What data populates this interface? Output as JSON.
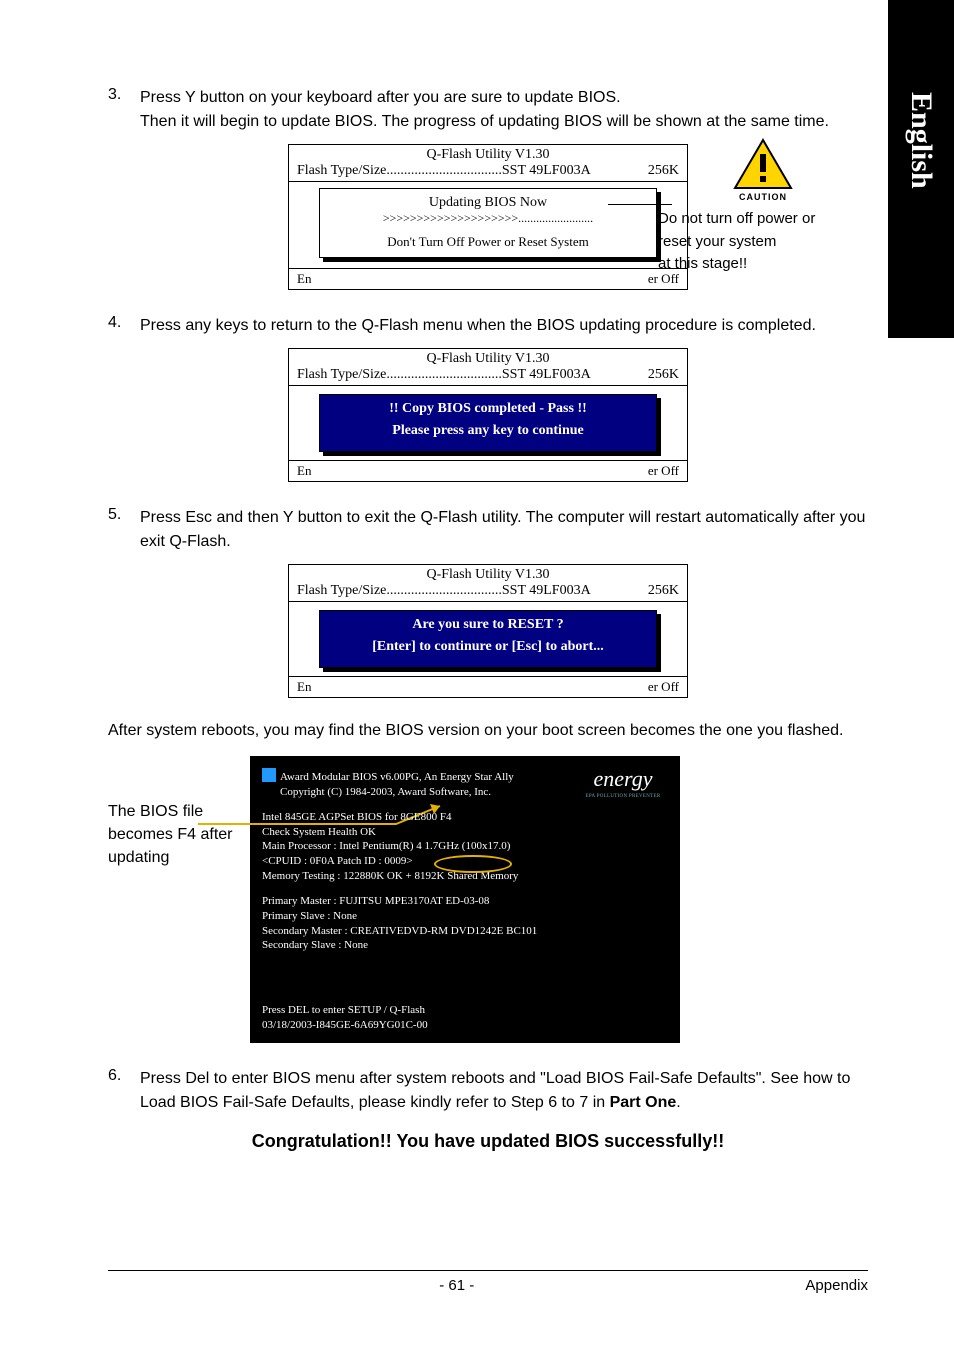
{
  "sideTab": {
    "language": "English"
  },
  "steps": {
    "s3": {
      "num": "3.",
      "line1": "Press Y button on your keyboard after you are sure to update BIOS.",
      "line2": "Then it will begin to update BIOS. The progress of updating BIOS will be shown at the same time."
    },
    "s4": {
      "num": "4.",
      "text": "Press any keys to return to the Q-Flash menu when the BIOS updating procedure is completed."
    },
    "s5": {
      "num": "5.",
      "text": "Press Esc and then Y button to exit the Q-Flash utility. The computer will restart automatically after you exit Q-Flash."
    },
    "s6": {
      "num": "6.",
      "textA": "Press Del to enter BIOS menu after system reboots and \"Load BIOS Fail-Safe Defaults\". See how to Load BIOS Fail-Safe Defaults, please kindly refer to Step 6 to 7 in ",
      "textB": "Part One",
      "textC": "."
    }
  },
  "qflash": {
    "title": "Q-Flash Utility V1.30",
    "flashLabel": "Flash Type/Size.................................SST 49LF003A",
    "flashSize": "256K",
    "footEn": "En",
    "footOff": "er Off",
    "box1": {
      "heading": "Updating BIOS Now",
      "progress": ">>>>>>>>>>>>>>>>>>>>.........................",
      "warn": "Don't Turn Off Power or Reset System"
    },
    "box2": {
      "l1": "!! Copy BIOS completed - Pass !!",
      "l2": "Please press any key to continue"
    },
    "box3": {
      "l1": "Are you sure to RESET ?",
      "l2": "[Enter] to continure or [Esc] to abort..."
    }
  },
  "caution": {
    "label": "CAUTION",
    "text1": "Do not turn off power or",
    "text2": "reset your system",
    "text3": "at this stage!!"
  },
  "afterReboot": "After system reboots, you may find the BIOS version on your boot screen becomes the one you flashed.",
  "bootLabel": "The BIOS file becomes F4 after updating",
  "boot": {
    "l1": "Award Modular BIOS v6.00PG, An Energy Star Ally",
    "l2": "Copyright (C) 1984-2003, Award Software, Inc.",
    "l3": "Intel 845GE AGPSet BIOS for 8GE800 F4",
    "l4": "Check System Health OK",
    "l5": "Main Processor : Intel Pentium(R) 4  1.7GHz (100x17.0)",
    "l6": "<CPUID : 0F0A Patch ID  : 0009>",
    "l7": "Memory Testing   :  122880K OK + 8192K Shared Memory",
    "l8": "Primary Master : FUJITSU MPE3170AT ED-03-08",
    "l9": "Primary Slave : None",
    "l10": "Secondary Master : CREATIVEDVD-RM DVD1242E BC101",
    "l11": "Secondary Slave : None",
    "l12": "Press DEL to enter SETUP / Q-Flash",
    "l13": "03/18/2003-I845GE-6A69YG01C-00",
    "logoEnergy": "energy",
    "logoEpa": "EPA  POLLUTION  PREVENTER"
  },
  "congrat": "Congratulation!! You have updated BIOS successfully!!",
  "footer": {
    "page": "- 61 -",
    "section": "Appendix"
  }
}
